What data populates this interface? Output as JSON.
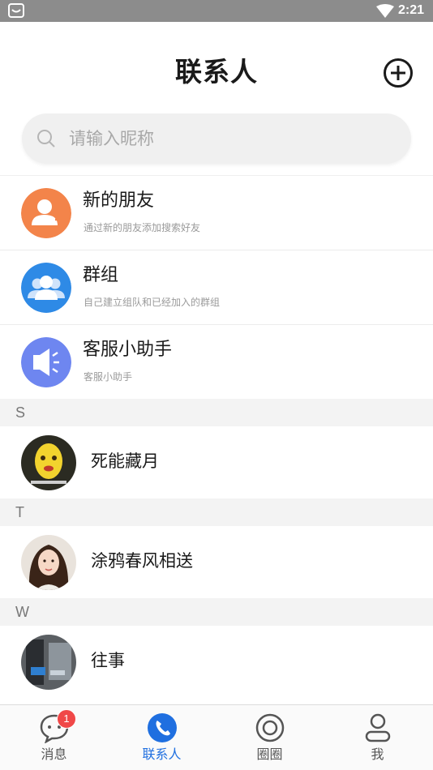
{
  "status_bar": {
    "time": "2:21"
  },
  "header": {
    "title": "联系人"
  },
  "search": {
    "placeholder": "请输入昵称"
  },
  "function_items": [
    {
      "label": "新的朋友",
      "sub": "通过新的朋友添加搜索好友",
      "color": "#f3844a"
    },
    {
      "label": "群组",
      "sub": "自己建立组队和已经加入的群组",
      "color": "#2e8ae6"
    },
    {
      "label": "客服小助手",
      "sub": "客服小助手",
      "color": "#6e86f0"
    }
  ],
  "sections": [
    {
      "letter": "S",
      "contacts": [
        {
          "name": "死能藏月"
        }
      ]
    },
    {
      "letter": "T",
      "contacts": [
        {
          "name": "涂鸦春风相送"
        }
      ]
    },
    {
      "letter": "W",
      "contacts": [
        {
          "name": "往事"
        }
      ]
    }
  ],
  "tabs": [
    {
      "label": "消息",
      "icon": "message-icon",
      "badge": "1"
    },
    {
      "label": "联系人",
      "icon": "phone-icon",
      "active": true
    },
    {
      "label": "圈圈",
      "icon": "circle-icon"
    },
    {
      "label": "我",
      "icon": "person-icon"
    }
  ],
  "colors": {
    "accent": "#1f6fe0",
    "badge": "#f04848",
    "section_bg": "#f3f3f3"
  }
}
